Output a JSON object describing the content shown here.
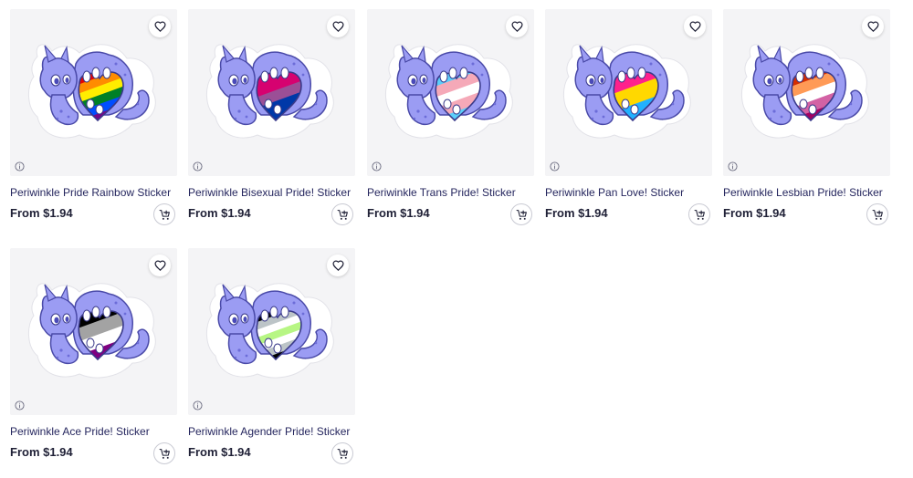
{
  "products": [
    {
      "title": "Periwinkle Pride Rainbow Sticker",
      "price": "From $1.94",
      "flag_colors": [
        "#e40303",
        "#ff8c00",
        "#ffed00",
        "#008026",
        "#004dff",
        "#750787"
      ]
    },
    {
      "title": "Periwinkle Bisexual Pride! Sticker",
      "price": "From $1.94",
      "flag_colors": [
        "#d60270",
        "#d60270",
        "#9b4f96",
        "#0038a8",
        "#0038a8"
      ]
    },
    {
      "title": "Periwinkle Trans Pride! Sticker",
      "price": "From $1.94",
      "flag_colors": [
        "#5bcefa",
        "#f5a9b8",
        "#ffffff",
        "#f5a9b8",
        "#5bcefa"
      ]
    },
    {
      "title": "Periwinkle Pan Love! Sticker",
      "price": "From $1.94",
      "flag_colors": [
        "#ff218c",
        "#ff218c",
        "#ffd800",
        "#ffd800",
        "#21b1ff",
        "#21b1ff"
      ]
    },
    {
      "title": "Periwinkle Lesbian Pride! Sticker",
      "price": "From $1.94",
      "flag_colors": [
        "#d52d00",
        "#ff9a56",
        "#ffffff",
        "#d362a4",
        "#a30262"
      ]
    },
    {
      "title": "Periwinkle Ace Pride! Sticker",
      "price": "From $1.94",
      "flag_colors": [
        "#000000",
        "#a3a3a3",
        "#ffffff",
        "#800080"
      ]
    },
    {
      "title": "Periwinkle Agender Pride! Sticker",
      "price": "From $1.94",
      "flag_colors": [
        "#000000",
        "#bcc4c7",
        "#ffffff",
        "#b7f684",
        "#ffffff",
        "#bcc4c7",
        "#000000"
      ]
    }
  ],
  "icons": {
    "favorite": "heart-outline-icon",
    "info": "info-circle-icon",
    "cart": "add-to-cart-icon"
  },
  "colors": {
    "dragon_body": "#9b9cf3",
    "dragon_light": "#c9caf9",
    "dragon_outline": "#4a4aa8",
    "title_text": "#25265e",
    "card_bg": "#f4f4f6"
  }
}
